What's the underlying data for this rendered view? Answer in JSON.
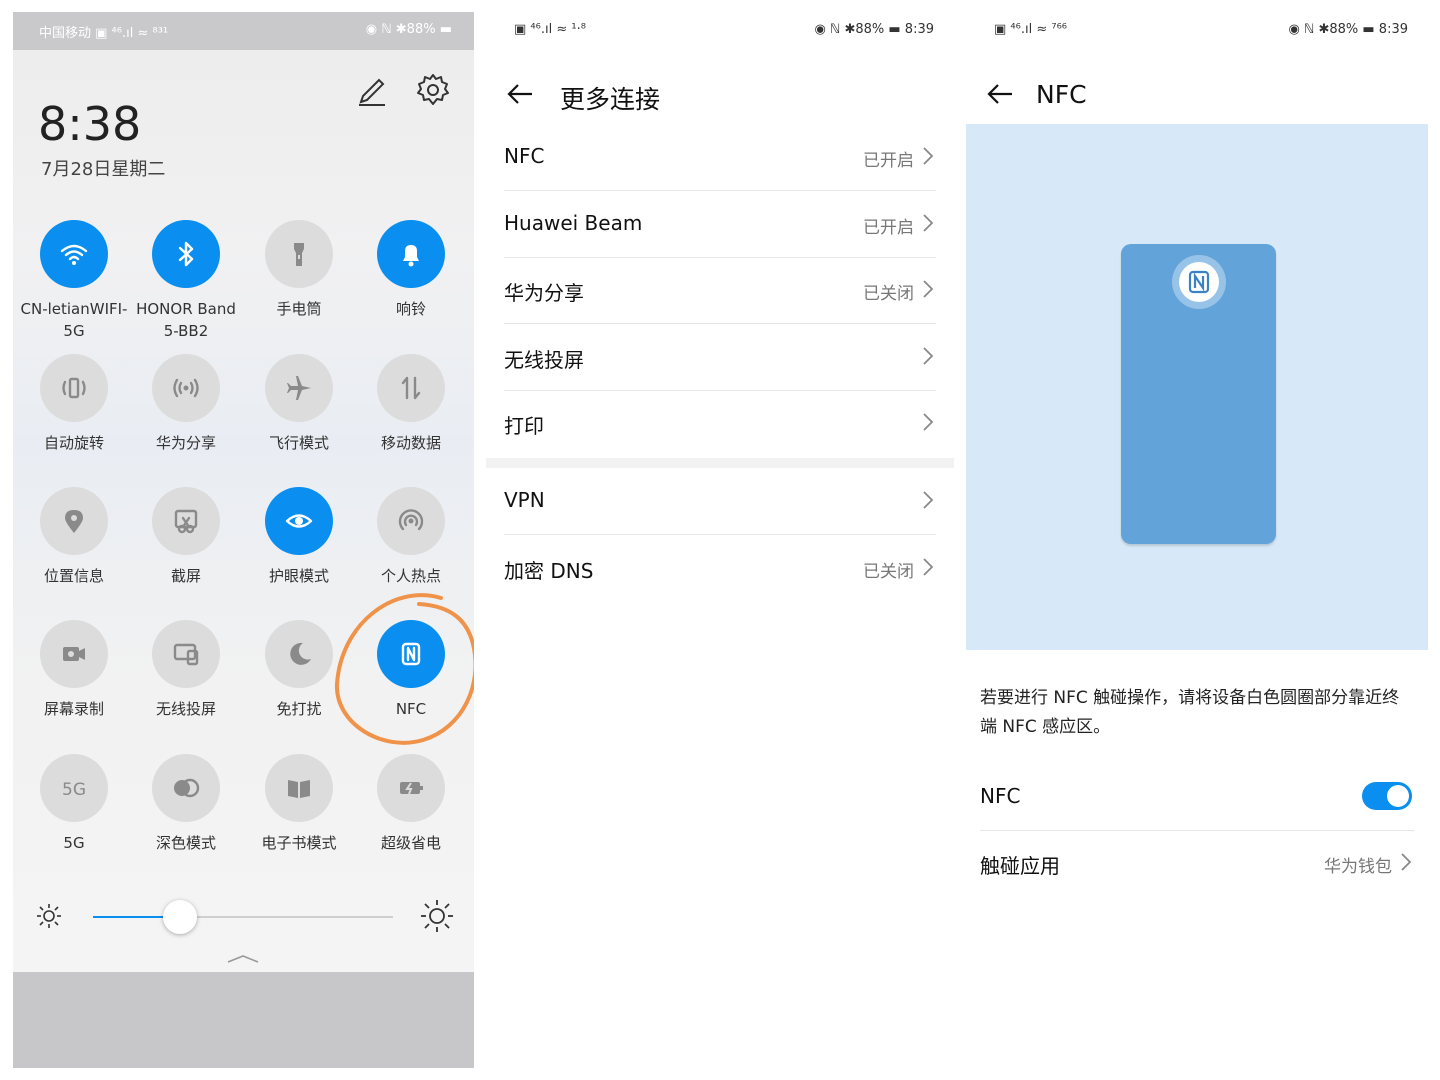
{
  "panel1": {
    "status_left": "中国移动 ▣ ⁴⁶.ıl ≈ ⁸³¹",
    "status_right": "◉ ℕ ✱88% ▬",
    "time": "8:38",
    "date": "7月28日星期二",
    "tiles": [
      {
        "label": "CN-letianWIFI-\n5G",
        "icon": "wifi-icon",
        "on": true
      },
      {
        "label": "HONOR Band\n5-BB2",
        "icon": "bluetooth-icon",
        "on": true
      },
      {
        "label": "手电筒",
        "icon": "flashlight-icon",
        "on": false
      },
      {
        "label": "响铃",
        "icon": "bell-icon",
        "on": true
      },
      {
        "label": "自动旋转",
        "icon": "rotate-icon",
        "on": false
      },
      {
        "label": "华为分享",
        "icon": "share-icon",
        "on": false
      },
      {
        "label": "飞行模式",
        "icon": "airplane-icon",
        "on": false
      },
      {
        "label": "移动数据",
        "icon": "data-icon",
        "on": false
      },
      {
        "label": "位置信息",
        "icon": "location-icon",
        "on": false
      },
      {
        "label": "截屏",
        "icon": "screenshot-icon",
        "on": false
      },
      {
        "label": "护眼模式",
        "icon": "eye-icon",
        "on": true
      },
      {
        "label": "个人热点",
        "icon": "hotspot-icon",
        "on": false
      },
      {
        "label": "屏幕录制",
        "icon": "record-icon",
        "on": false
      },
      {
        "label": "无线投屏",
        "icon": "cast-icon",
        "on": false
      },
      {
        "label": "免打扰",
        "icon": "moon-icon",
        "on": false
      },
      {
        "label": "NFC",
        "icon": "nfc-icon",
        "on": true
      },
      {
        "label": "5G",
        "icon": "5g-icon",
        "on": false
      },
      {
        "label": "深色模式",
        "icon": "dark-mode-icon",
        "on": false
      },
      {
        "label": "电子书模式",
        "icon": "ebook-icon",
        "on": false
      },
      {
        "label": "超级省电",
        "icon": "battery-saver-icon",
        "on": false
      }
    ],
    "brightness": 0.29,
    "accent": "#0a8ff0",
    "annotation_color": "#f0934a"
  },
  "panel2": {
    "status_left": "▣ ⁴⁶.ıl ≈ ¹·⁸",
    "status_right": "◉ ℕ ✱88% ▬ 8:39",
    "title": "更多连接",
    "rows": [
      {
        "label": "NFC",
        "value": "已开启"
      },
      {
        "label": "Huawei Beam",
        "value": "已开启"
      },
      {
        "label": "华为分享",
        "value": "已关闭"
      },
      {
        "label": "无线投屏",
        "value": ""
      },
      {
        "label": "打印",
        "value": ""
      }
    ],
    "rows2": [
      {
        "label": "VPN",
        "value": ""
      },
      {
        "label": "加密 DNS",
        "value": "已关闭"
      }
    ]
  },
  "panel3": {
    "status_left": "▣ ⁴⁶.ıl ≈ ⁷⁶⁶",
    "status_right": "◉ ℕ ✱88% ▬ 8:39",
    "title": "NFC",
    "description": "若要进行 NFC 触碰操作，请将设备白色圆圈部分靠近终端 NFC 感应区。",
    "nfc_label": "NFC",
    "nfc_enabled": true,
    "touch_label": "触碰应用",
    "touch_value": "华为钱包"
  }
}
